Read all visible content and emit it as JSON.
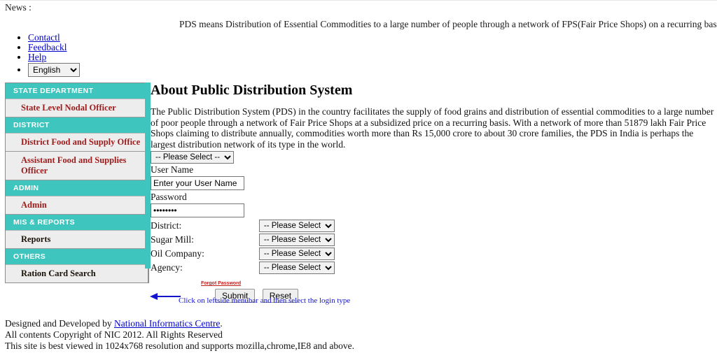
{
  "news": {
    "label": "News :",
    "marquee": "PDS means Distribution of Essential Commodities to a large number of people through a network of FPS(Fair Price Shops) on a recurring basis."
  },
  "util_links": [
    {
      "label": "Contactl"
    },
    {
      "label": "Feedbackl"
    },
    {
      "label": "Help"
    }
  ],
  "language": {
    "selected": "English",
    "options": [
      "English"
    ]
  },
  "sidebar": {
    "groups": [
      {
        "heading": "STATE DEPARTMENT",
        "items": [
          {
            "label": "State Level Nodal Officer",
            "style": "red"
          }
        ]
      },
      {
        "heading": "DISTRICT",
        "items": [
          {
            "label": "District Food and Supply Office",
            "style": "red"
          },
          {
            "label": "Assistant Food and Supplies Officer",
            "style": "red"
          }
        ]
      },
      {
        "heading": "ADMIN",
        "items": [
          {
            "label": "Admin",
            "style": "red"
          }
        ]
      },
      {
        "heading": "MIS & REPORTS",
        "items": [
          {
            "label": "Reports",
            "style": "dark"
          }
        ]
      },
      {
        "heading": "OTHERS",
        "items": [
          {
            "label": "Ration Card Search",
            "style": "dark"
          }
        ]
      }
    ]
  },
  "main": {
    "title": "About Public Distribution System",
    "intro": "The Public Distribution System (PDS) in the country facilitates the supply of food grains and distribution of essential commodities to a large number of poor people through a network of Fair Price Shops at a subsidized price on a recurring basis. With a network of more than 51879 lakh Fair Price Shops claiming to distribute annually, commodities worth more than Rs 15,000 crore to about 30 crore families, the PDS in India is perhaps the largest distribution network of its type in the world."
  },
  "form": {
    "login_type": {
      "selected": "-- Please Select --",
      "options": [
        "-- Please Select --"
      ]
    },
    "username": {
      "label": "User Name",
      "value": "",
      "placeholder": "Enter your User Name"
    },
    "password": {
      "label": "Password",
      "value": "••••••••"
    },
    "selects": [
      {
        "label": "District:",
        "selected": "-- Please Select --"
      },
      {
        "label": "Sugar Mill:",
        "selected": "-- Please Select --"
      },
      {
        "label": "Oil Company:",
        "selected": "-- Please Select --"
      },
      {
        "label": "Agency:",
        "selected": "-- Please Select --"
      }
    ],
    "forgot_password": "Forgot Password",
    "submit_label": "Submit",
    "reset_label": "Reset"
  },
  "hint": {
    "text": "Click on leftside menubar and then select the login type",
    "arrow_color": "#1414cf"
  },
  "footer": {
    "line1_prefix": "Designed and Developed by ",
    "line1_link": "National Informatics Centre",
    "line1_suffix": ".",
    "line2": "All contents Copyright of NIC 2012. All Rights Reserved",
    "line3": "This site is best viewed in 1024x768 resolution and supports mozilla,chrome,IE8 and above."
  },
  "colors": {
    "teal": "#3ec6be",
    "menu_red": "#9e1b1b",
    "link_blue": "#0000cc",
    "hint_blue": "#1414cf"
  }
}
